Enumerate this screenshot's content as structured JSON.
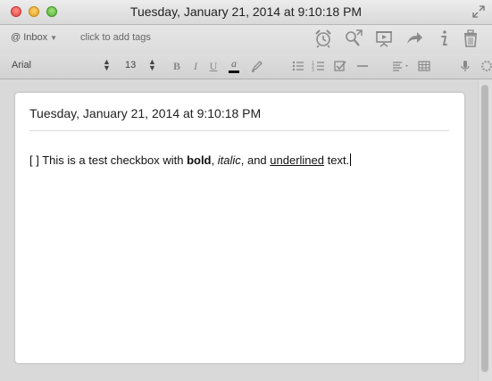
{
  "window": {
    "title": "Tuesday, January 21, 2014 at 9:10:18 PM"
  },
  "toolbar": {
    "notebook": "@ Inbox",
    "tags_placeholder": "click to add tags",
    "icons": [
      "alarm-clock-icon",
      "share-search-icon",
      "presentation-icon",
      "share-arrow-icon",
      "info-icon",
      "trash-icon"
    ]
  },
  "format_bar": {
    "font": "Arial",
    "size": "13",
    "bold": "B",
    "italic": "I",
    "underline": "U",
    "color": "a",
    "text_color": "#111111"
  },
  "note": {
    "title": "Tuesday, January 21, 2014 at 9:10:18 PM",
    "body": {
      "prefix": "[ ] This is a test checkbox with ",
      "bold": "bold",
      "sep1": ", ",
      "italic": "italic",
      "sep2": ", and ",
      "underlined": "underlined",
      "suffix": " text."
    }
  }
}
